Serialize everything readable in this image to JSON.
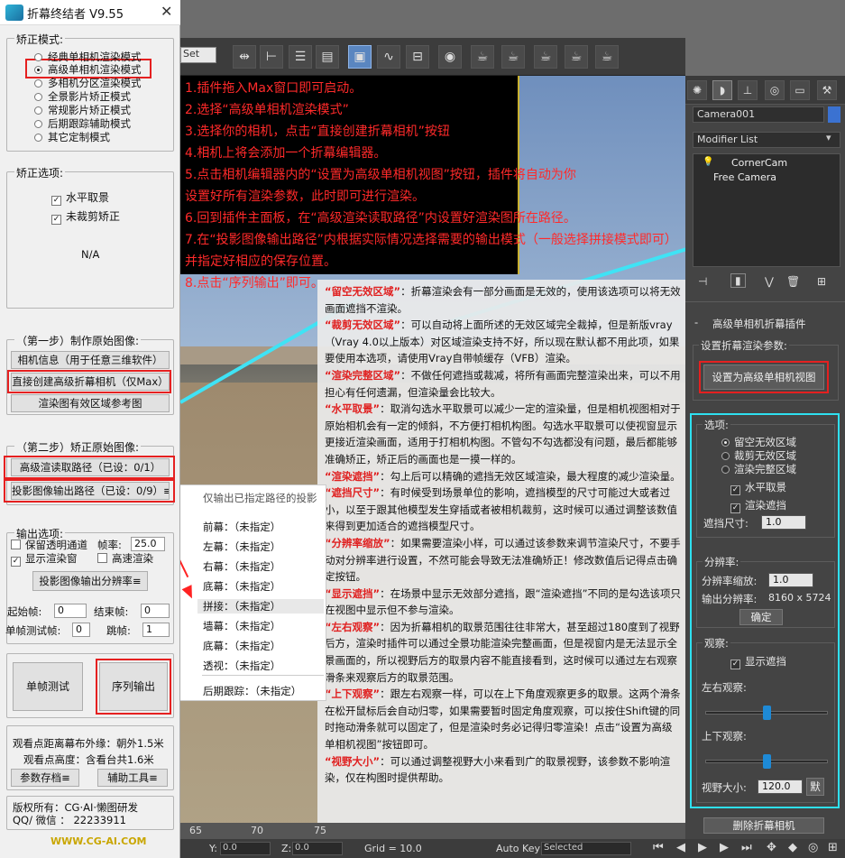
{
  "plugin": {
    "title": "折幕终结者 V9.55",
    "close": "✕",
    "mode_group": "矫正模式:",
    "modes": [
      "经典单相机渲染模式",
      "高级单相机渲染模式",
      "多相机分区渲染模式",
      "全景影片矫正模式",
      "常规影片矫正模式",
      "后期跟踪辅助模式",
      "其它定制模式"
    ],
    "selected_mode": 1,
    "options_group": "矫正选项:",
    "opt_horizontal": "水平取景",
    "opt_uncropped": "未裁剪矫正",
    "na": "N/A",
    "step1_group": "（第一步）制作原始图像:",
    "btn_camera_info": "相机信息（用于任意三维软件）",
    "btn_create_camera": "直接创建高级折幕相机（仅Max）",
    "btn_render_ref": "渲染图有效区域参考图",
    "step2_group": "（第二步）矫正原始图像:",
    "btn_read_path": "高级渲读取路径（已设：0/1）",
    "btn_output_path": "投影图像输出路径（已设：0/9）≡",
    "output_group": "输出选项:",
    "chk_alpha": "保留透明通道",
    "frame_rate_label": "帧率:",
    "frame_rate": "25.0",
    "chk_show_window": "显示渲染窗",
    "chk_fast_render": "高速渲染",
    "btn_resolution": "投影图像输出分辨率≡",
    "start_label": "起始帧:",
    "start_value": "0",
    "end_label": "结束帧:",
    "end_value": "0",
    "single_label": "单帧测试帧:",
    "single_value": "0",
    "skip_label": "跳帧:",
    "skip_value": "1",
    "btn_single_test": "单帧测试",
    "btn_sequence": "序列输出",
    "dist_line1": "观看点距离幕布外缘：朝外1.5米",
    "dist_line2": "观看点高度：含看台共1.6米",
    "btn_param_file": "参数存档≡",
    "btn_tools": "辅助工具≡",
    "copyright": "版权所有：CG·AI·懒图研发",
    "qq": "QQ/ 微信 ： 22233911",
    "website": "WWW.CG-AI.COM"
  },
  "steps": [
    "1.插件拖入Max窗口即可启动。",
    "2.选择“高级单相机渲染模式”",
    "3.选择你的相机，点击“直接创建折幕相机”按钮",
    "4.相机上将会添加一个折幕编辑器。",
    "5.点击相机编辑器内的“设置为高级单相机视图”按钮，插件将自动为你",
    "设置好所有渲染参数，此时即可进行渲染。",
    "6.回到插件主面板，在“高级渲染读取路径”内设置好渲染图所在路径。",
    "7.在“投影图像输出路径”内根据实际情况选择需要的输出模式（一般选择拼接模式即可）",
    "并指定好相应的保存位置。",
    "8.点击“序列输出”即可。"
  ],
  "popup": {
    "title": "仅输出已指定路径的投影",
    "items": [
      "前幕：（未指定）",
      "左幕：（未指定）",
      "右幕：（未指定）",
      "底幕：（未指定）",
      "拼接：（未指定）",
      "墙幕：（未指定）",
      "底幕：（未指定）",
      "透视：（未指定）"
    ],
    "tracking": "后期跟踪：（未指定）"
  },
  "info": [
    {
      "hl": "“留空无效区域”",
      "text": "：折幕渲染会有一部分画面是无效的，使用该选项可以将无效画面遮挡不渲染。"
    },
    {
      "hl": "“裁剪无效区域”",
      "text": "：可以自动将上面所述的无效区域完全裁掉，但是新版vray（Vray 4.0以上版本）对区域渲染支持不好，所以现在默认都不用此项，如果要使用本选项，请使用Vray自带帧缓存（VFB）渲染。"
    },
    {
      "hl": "“渲染完整区域”",
      "text": "：不做任何遮挡或裁减，将所有画面完整渲染出来，可以不用担心有任何遗漏，但渲染量会比较大。"
    },
    {
      "hl": "“水平取景”",
      "text": "：取消勾选水平取景可以减少一定的渲染量，但是相机视图相对于原始相机会有一定的倾斜，不方便打相机构图。勾选水平取景可以使视窗显示更接近渲染画面，适用于打相机构图。不管勾不勾选都没有问题，最后都能够准确矫正，矫正后的画面也是一摸一样的。"
    },
    {
      "hl": "“渲染遮挡”",
      "text": "：勾上后可以精确的遮挡无效区域渲染，最大程度的减少渲染量。"
    },
    {
      "hl": "“遮挡尺寸”",
      "text": "：有时候受到场景单位的影响，遮挡模型的尺寸可能过大或者过小，以至于跟其他模型发生穿插或者被相机裁剪，这时候可以通过调整该数值来得到更加适合的遮挡模型尺寸。"
    },
    {
      "hl": "“分辨率缩放”",
      "text": "：如果需要渲染小样，可以通过该参数来调节渲染尺寸，不要手动对分辨率进行设置，不然可能会导致无法准确矫正！修改数值后记得点击确定按钮。"
    },
    {
      "hl": "“显示遮挡”",
      "text": "：在场景中显示无效部分遮挡，跟“渲染遮挡”不同的是勾选该项只在视图中显示但不参与渲染。"
    },
    {
      "hl": "“左右观察”",
      "text": "：因为折幕相机的取景范围往往非常大，甚至超过180度到了视野后方，渲染时插件可以通过全景功能渲染完整画面，但是视窗内是无法显示全景画面的，所以视野后方的取景内容不能直接看到，这时候可以通过左右观察滑条来观察后方的取景范围。"
    },
    {
      "hl": "“上下观察”",
      "text": "：跟左右观察一样，可以在上下角度观察更多的取景。这两个滑条在松开鼠标后会自动归零，如果需要暂时固定角度观察，可以按住Shift键的同时拖动滑条就可以固定了，但是渲染时务必记得归零渲染！点击“设置为高级单相机视图”按钮即可。"
    },
    {
      "hl": "“视野大小”",
      "text": "：可以通过调整视野大小来看到广的取景视野，该参数不影响渲染，仅在构图时提供帮助。"
    }
  ],
  "max": {
    "set_dropdown": "Set",
    "timeline_ticks": [
      "65",
      "70",
      "75"
    ],
    "status": {
      "y_label": "Y:",
      "y_value": "0.0",
      "z_label": "Z:",
      "z_value": "0.0",
      "grid": "Grid = 10.0",
      "autokey": "Auto Key",
      "selected": "Selected"
    }
  },
  "rpanel": {
    "object_name": "Camera001",
    "modifier_list": "Modifier List",
    "stack_items": [
      "CornerCam",
      "Free Camera"
    ],
    "rollout_title": "高级单相机折幕插件",
    "render_params_group": "设置折幕渲染参数:",
    "btn_set_view": "设置为高级单相机视图",
    "options_group": "选项:",
    "radios": [
      "留空无效区域",
      "裁剪无效区域",
      "渲染完整区域"
    ],
    "selected_radio": 0,
    "chk_horizontal": "水平取景",
    "chk_render_mask": "渲染遮挡",
    "mask_size_label": "遮挡尺寸:",
    "mask_size_value": "1.0",
    "resolution_group": "分辨率:",
    "res_scale_label": "分辨率缩放:",
    "res_scale_value": "1.0",
    "output_res_label": "输出分辨率:",
    "output_res_value": "8160 x 5724",
    "btn_confirm": "确定",
    "observe_group": "观察:",
    "chk_show_mask": "显示遮挡",
    "lr_label": "左右观察:",
    "lr_level": 0.5,
    "ud_label": "上下观察:",
    "ud_level": 0.5,
    "fov_label": "视野大小:",
    "fov_value": "120.0",
    "btn_default": "默",
    "btn_delete": "删除折幕相机"
  },
  "colors": {
    "step_text": "#ff2a2a",
    "highlight_box": "#e52020",
    "cyan_frame": "#2ee0f0",
    "slider_thumb": "#1e8ad6"
  }
}
